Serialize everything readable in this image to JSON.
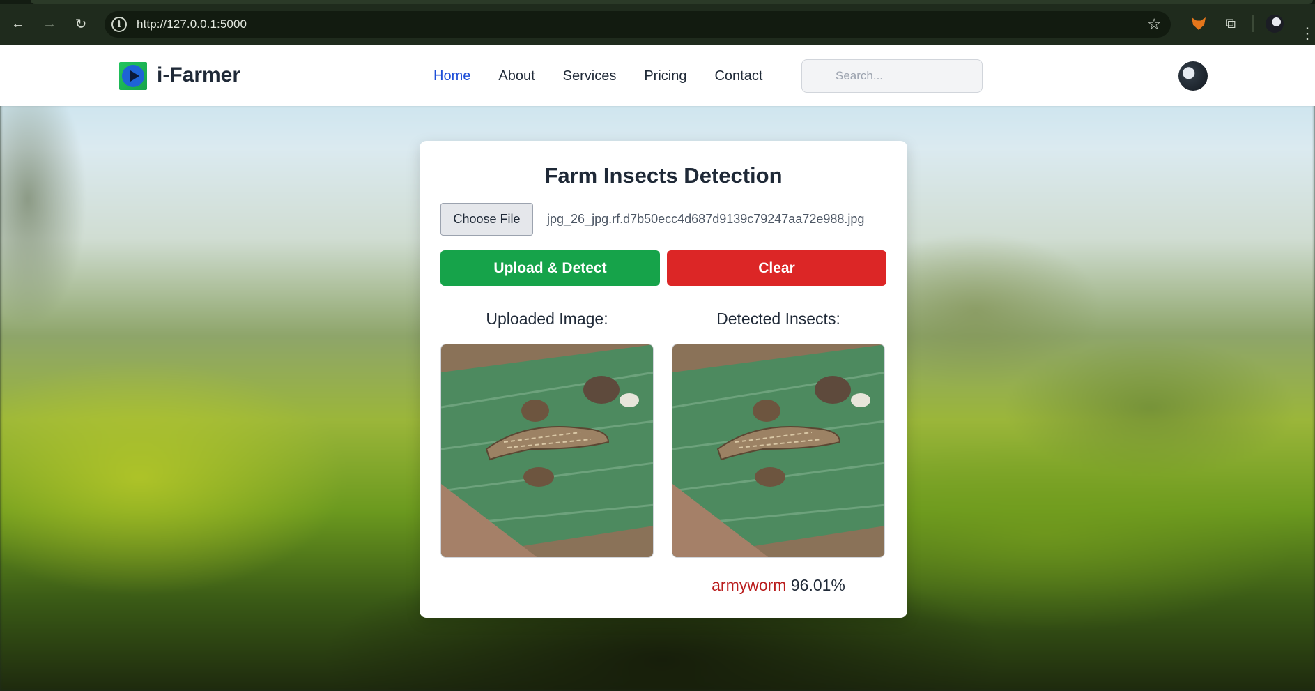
{
  "browser": {
    "url": "http://127.0.0.1:5000"
  },
  "navbar": {
    "brand": "i-Farmer",
    "items": [
      {
        "label": "Home",
        "active": true
      },
      {
        "label": "About"
      },
      {
        "label": "Services"
      },
      {
        "label": "Pricing"
      },
      {
        "label": "Contact"
      }
    ],
    "search_placeholder": "Search..."
  },
  "card": {
    "title": "Farm Insects Detection",
    "choose_file_label": "Choose File",
    "file_name": "jpg_26_jpg.rf.d7b50ecc4d687d9139c79247aa72e988.jpg",
    "upload_label": "Upload & Detect",
    "clear_label": "Clear",
    "uploaded_label": "Uploaded Image:",
    "detected_label": "Detected Insects:",
    "result": {
      "insect": "armyworm",
      "confidence": "96.01%"
    }
  },
  "colors": {
    "upload": "#16a34a",
    "clear": "#dc2626",
    "active_link": "#1d4ed8",
    "result_label": "#b91c1c"
  }
}
